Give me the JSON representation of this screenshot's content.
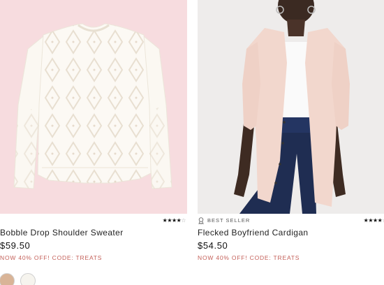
{
  "products": [
    {
      "title": "Bobble Drop Shoulder Sweater",
      "price": "$59.50",
      "promo": "NOW 40% OFF! CODE: TREATS",
      "rating_stars": 4,
      "rating_max": 5,
      "badge": "",
      "swatches": [
        {
          "name": "tan",
          "color": "#d9b497"
        },
        {
          "name": "white",
          "color": "#f6f4ee"
        }
      ]
    },
    {
      "title": "Flecked Boyfriend Cardigan",
      "price": "$54.50",
      "promo": "NOW 40% OFF! CODE: TREATS",
      "rating_stars": 4,
      "rating_max": 5,
      "badge": "BEST SELLER",
      "swatches": []
    }
  ],
  "colors": {
    "promo": "#c4615a",
    "left_photo_bg": "#f7dcdf",
    "right_photo_bg": "#eeeceb"
  }
}
